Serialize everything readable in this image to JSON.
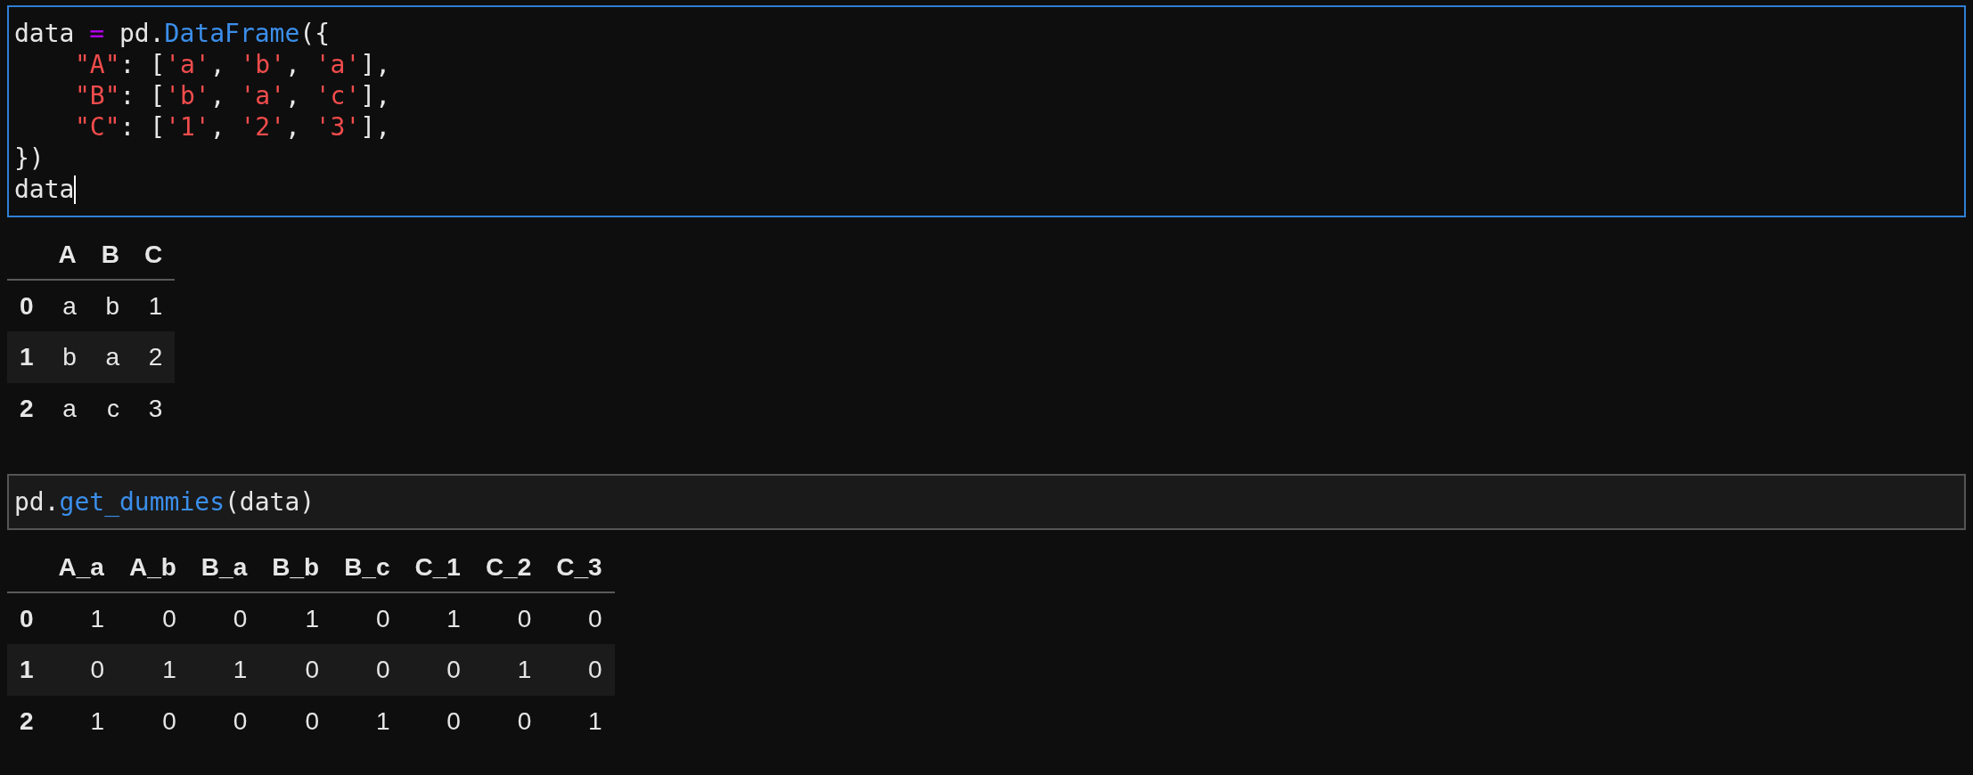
{
  "cells": [
    {
      "selected": true,
      "has_cursor": true,
      "lines": [
        [
          {
            "kind": "text",
            "text": "data "
          },
          {
            "kind": "operator",
            "text": "="
          },
          {
            "kind": "text",
            "text": " pd."
          },
          {
            "kind": "function",
            "text": "DataFrame"
          },
          {
            "kind": "text",
            "text": "({"
          }
        ],
        [
          {
            "kind": "indent"
          },
          {
            "kind": "string",
            "text": "\"A\""
          },
          {
            "kind": "text",
            "text": ": ["
          },
          {
            "kind": "string",
            "text": "'a'"
          },
          {
            "kind": "text",
            "text": ", "
          },
          {
            "kind": "string",
            "text": "'b'"
          },
          {
            "kind": "text",
            "text": ", "
          },
          {
            "kind": "string",
            "text": "'a'"
          },
          {
            "kind": "text",
            "text": "],"
          }
        ],
        [
          {
            "kind": "indent"
          },
          {
            "kind": "string",
            "text": "\"B\""
          },
          {
            "kind": "text",
            "text": ": ["
          },
          {
            "kind": "string",
            "text": "'b'"
          },
          {
            "kind": "text",
            "text": ", "
          },
          {
            "kind": "string",
            "text": "'a'"
          },
          {
            "kind": "text",
            "text": ", "
          },
          {
            "kind": "string",
            "text": "'c'"
          },
          {
            "kind": "text",
            "text": "],"
          }
        ],
        [
          {
            "kind": "indent"
          },
          {
            "kind": "string",
            "text": "\"C\""
          },
          {
            "kind": "text",
            "text": ": ["
          },
          {
            "kind": "string",
            "text": "'1'"
          },
          {
            "kind": "text",
            "text": ", "
          },
          {
            "kind": "string",
            "text": "'2'"
          },
          {
            "kind": "text",
            "text": ", "
          },
          {
            "kind": "string",
            "text": "'3'"
          },
          {
            "kind": "text",
            "text": "],"
          }
        ],
        [
          {
            "kind": "text",
            "text": "})"
          }
        ],
        [
          {
            "kind": "text",
            "text": "data"
          }
        ]
      ],
      "output": {
        "columns": [
          "A",
          "B",
          "C"
        ],
        "rows": [
          {
            "index": "0",
            "values": [
              "a",
              "b",
              "1"
            ]
          },
          {
            "index": "1",
            "values": [
              "b",
              "a",
              "2"
            ]
          },
          {
            "index": "2",
            "values": [
              "a",
              "c",
              "3"
            ]
          }
        ]
      }
    },
    {
      "selected": false,
      "lines": [
        [
          {
            "kind": "text",
            "text": "pd."
          },
          {
            "kind": "function",
            "text": "get_dummies"
          },
          {
            "kind": "text",
            "text": "(data)"
          }
        ]
      ],
      "output": {
        "columns": [
          "A_a",
          "A_b",
          "B_a",
          "B_b",
          "B_c",
          "C_1",
          "C_2",
          "C_3"
        ],
        "rows": [
          {
            "index": "0",
            "values": [
              "1",
              "0",
              "0",
              "1",
              "0",
              "1",
              "0",
              "0"
            ]
          },
          {
            "index": "1",
            "values": [
              "0",
              "1",
              "1",
              "0",
              "0",
              "0",
              "1",
              "0"
            ]
          },
          {
            "index": "2",
            "values": [
              "1",
              "0",
              "0",
              "0",
              "1",
              "0",
              "0",
              "1"
            ]
          }
        ]
      }
    }
  ]
}
